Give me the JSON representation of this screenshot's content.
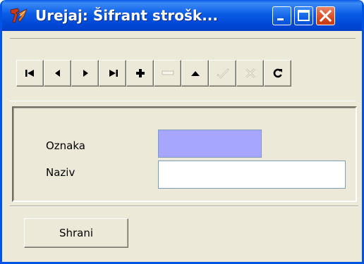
{
  "window": {
    "title": "Urejaj: Šifrant strošk...",
    "app_icon": "tcl-feather-icon",
    "caption_buttons": [
      "minimize-icon",
      "maximize-icon",
      "close-icon"
    ]
  },
  "toolbar": {
    "buttons": [
      {
        "name": "first-record-button",
        "icon": "first-icon",
        "enabled": true
      },
      {
        "name": "prior-record-button",
        "icon": "prior-icon",
        "enabled": true
      },
      {
        "name": "next-record-button",
        "icon": "next-icon",
        "enabled": true
      },
      {
        "name": "last-record-button",
        "icon": "last-icon",
        "enabled": true
      },
      {
        "name": "insert-button",
        "icon": "plus-icon",
        "enabled": true
      },
      {
        "name": "delete-button",
        "icon": "minus-icon",
        "enabled": false
      },
      {
        "name": "edit-button",
        "icon": "triangle-up-icon",
        "enabled": true
      },
      {
        "name": "post-button",
        "icon": "check-icon",
        "enabled": false
      },
      {
        "name": "cancel-button",
        "icon": "x-icon",
        "enabled": false
      },
      {
        "name": "refresh-button",
        "icon": "refresh-icon",
        "enabled": true
      }
    ]
  },
  "form": {
    "oznaka_label": "Oznaka",
    "oznaka_value": "",
    "naziv_label": "Naziv",
    "naziv_value": ""
  },
  "footer": {
    "save_label": "Shrani"
  },
  "colors": {
    "titlebar": "#0a5ce6",
    "close_button": "#d94f28",
    "window_bg": "#ece9d8",
    "oznaka_field_bg": "#a6a6ff",
    "naziv_field_bg": "#ffffff"
  }
}
